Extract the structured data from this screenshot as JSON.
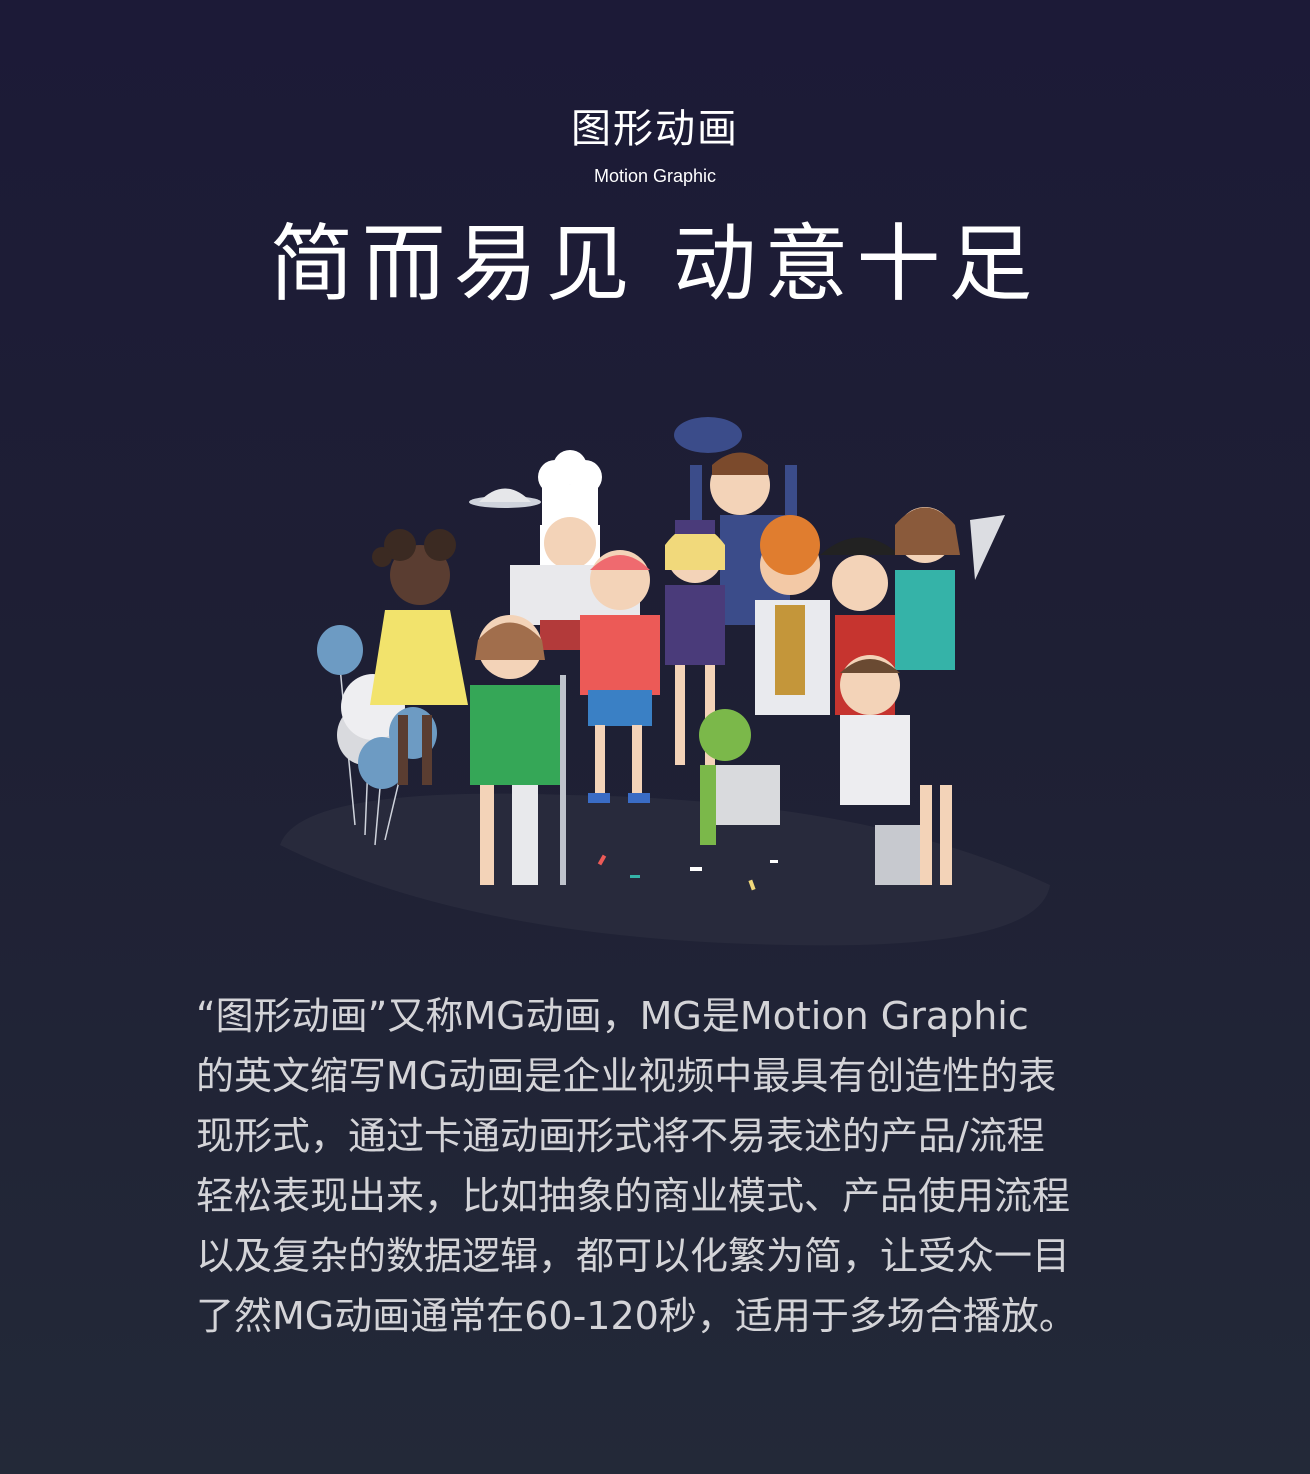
{
  "header": {
    "title_cn": "图形动画",
    "title_en": "Motion Graphic",
    "headline": "简而易见  动意十足"
  },
  "illustration": {
    "description_name": "group-of-cartoon-characters",
    "colors": {
      "floor": "#2a2b3d",
      "balloon_blue": "#6d9bc3",
      "balloon_white": "#e8e8ec"
    }
  },
  "body": {
    "lines": [
      "“图形动画”又称MG动画，MG是Motion Graphic",
      "的英文缩写MG动画是企业视频中最具有创造性的表",
      "现形式，通过卡通动画形式将不易表述的产品/流程",
      "轻松表现出来，比如抽象的商业模式、产品使用流程",
      "以及复杂的数据逻辑，都可以化繁为简，让受众一目",
      "了然MG动画通常在60-120秒，适用于多场合播放。"
    ]
  }
}
